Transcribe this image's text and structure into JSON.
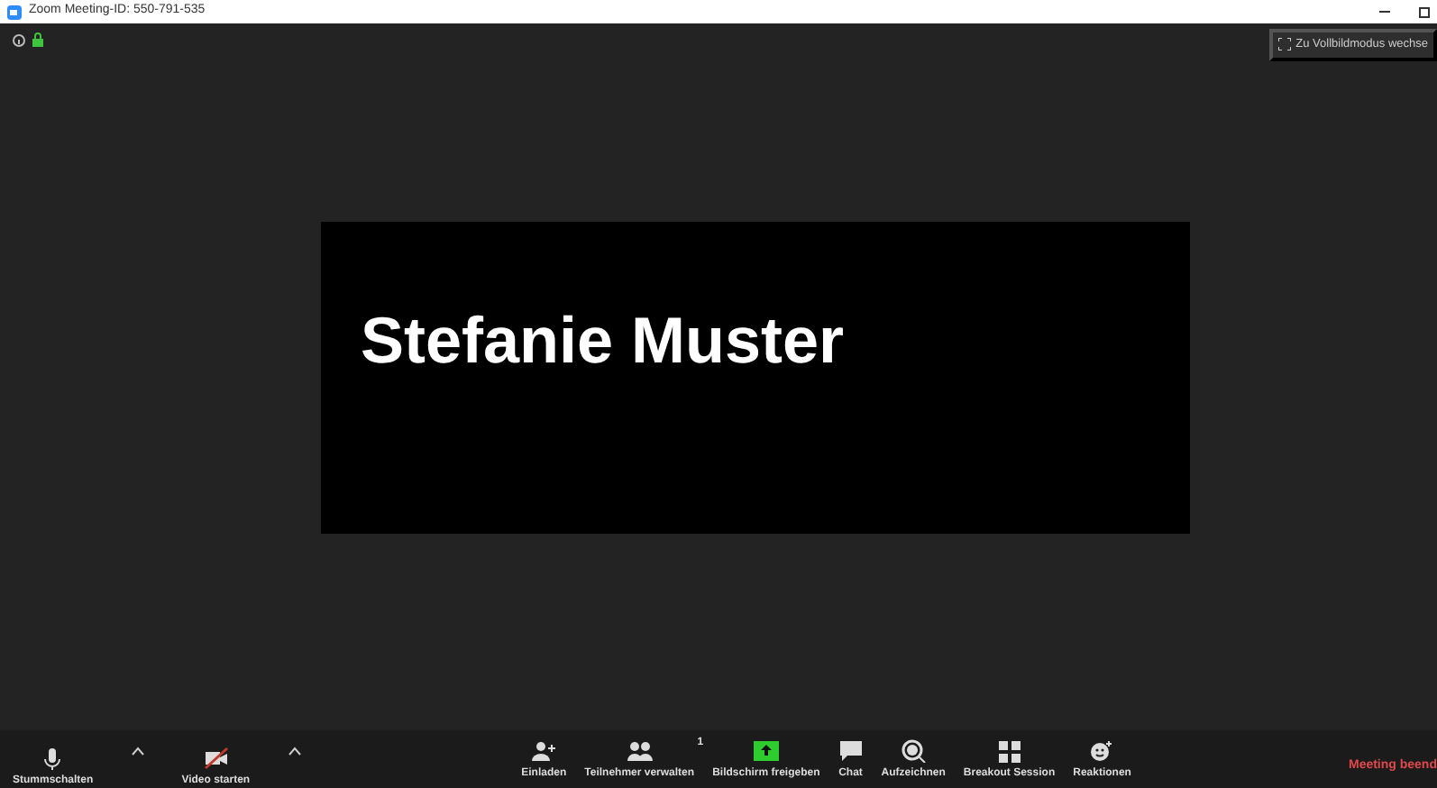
{
  "window": {
    "title": "Zoom Meeting-ID: 550-791-535"
  },
  "top_bar": {
    "fullscreen_label": "Zu Vollbildmodus wechse"
  },
  "participant_tile": {
    "name": "Stefanie Muster"
  },
  "toolbar": {
    "left": [
      {
        "kind": "mic",
        "label": "Stummschalten"
      },
      {
        "kind": "caret"
      },
      {
        "kind": "video_off",
        "label": "Video starten"
      },
      {
        "kind": "caret"
      }
    ],
    "center": [
      {
        "kind": "invite",
        "label": "Einladen"
      },
      {
        "kind": "participants",
        "label": "Teilnehmer verwalten",
        "count": "1"
      },
      {
        "kind": "share",
        "label": "Bildschirm freigeben"
      },
      {
        "kind": "chat",
        "label": "Chat"
      },
      {
        "kind": "record",
        "label": "Aufzeichnen"
      },
      {
        "kind": "breakout",
        "label": "Breakout Session"
      },
      {
        "kind": "reactions",
        "label": "Reaktionen"
      }
    ],
    "end_label": "Meeting beend"
  }
}
